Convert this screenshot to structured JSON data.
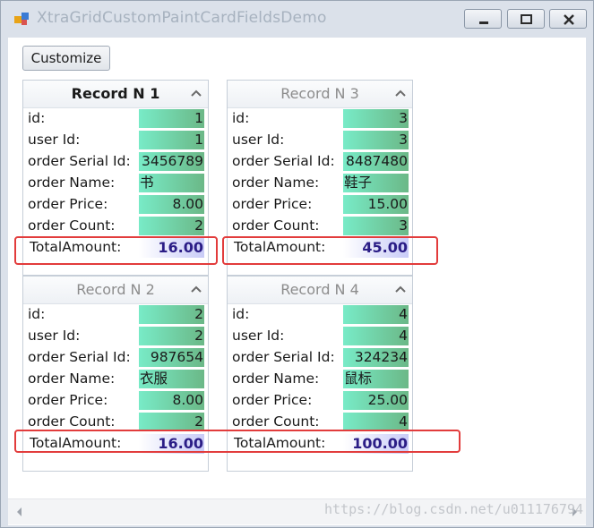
{
  "window": {
    "title": "XtraGridCustomPaintCardFieldsDemo",
    "buttons": {
      "minimize": "minimize",
      "maximize": "maximize",
      "close": "close"
    }
  },
  "toolbar": {
    "customize_label": "Customize"
  },
  "colors": {
    "field_value_gradient": [
      "#78ebc7",
      "#6bb887"
    ],
    "total_value_gradient": [
      "#ffffff",
      "#c9ccf7"
    ],
    "total_text": "#2b1d86",
    "highlight_border": "#e23c3c"
  },
  "field_labels": {
    "id": "id:",
    "user_id": "user Id:",
    "order_serial_id": "order Serial Id:",
    "order_name": "order Name:",
    "order_price": "order Price:",
    "order_count": "order Count:",
    "total_amount": "TotalAmount:"
  },
  "cards": [
    {
      "caption": "Record N 1",
      "focused": true,
      "id": "1",
      "user_id": "1",
      "order_serial_id": "3456789",
      "order_name": "书",
      "order_price": "8.00",
      "order_count": "2",
      "total_amount": "16.00"
    },
    {
      "caption": "Record N 3",
      "focused": false,
      "id": "3",
      "user_id": "3",
      "order_serial_id": "8487480",
      "order_name": "鞋子",
      "order_price": "15.00",
      "order_count": "3",
      "total_amount": "45.00"
    },
    {
      "caption": "Record N 2",
      "focused": false,
      "id": "2",
      "user_id": "2",
      "order_serial_id": "987654",
      "order_name": "衣服",
      "order_price": "8.00",
      "order_count": "2",
      "total_amount": "16.00"
    },
    {
      "caption": "Record N 4",
      "focused": false,
      "id": "4",
      "user_id": "4",
      "order_serial_id": "324234",
      "order_name": "鼠标",
      "order_price": "25.00",
      "order_count": "4",
      "total_amount": "100.00"
    }
  ],
  "watermark": "https://blog.csdn.net/u011176794"
}
